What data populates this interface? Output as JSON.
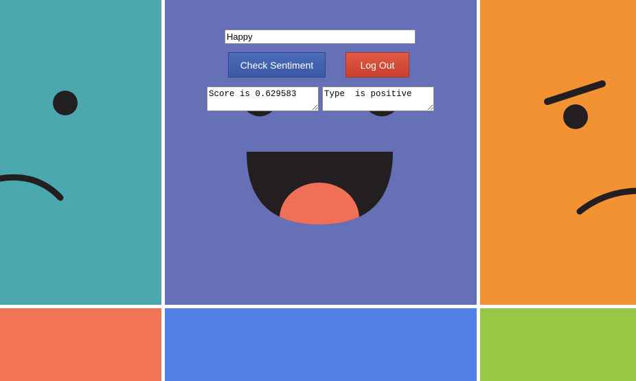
{
  "colors": {
    "teal": "#4aa8ae",
    "purple": "#6670b6",
    "orange": "#f29233",
    "coral": "#f07455",
    "blue": "#5380e6",
    "green": "#98c846",
    "feature": "#231f20",
    "tongue": "#ef7056",
    "primary_button": "#4565b2",
    "danger_button": "#d64e3b"
  },
  "form": {
    "input_value": "Happy",
    "check_label": "Check Sentiment",
    "logout_label": "Log Out"
  },
  "results": {
    "score_text": "Score is 0.629583",
    "type_text": "Type  is positive"
  },
  "icons": {
    "left": "sad-face-icon",
    "center": "laughing-face-icon",
    "right": "frowning-face-icon"
  }
}
